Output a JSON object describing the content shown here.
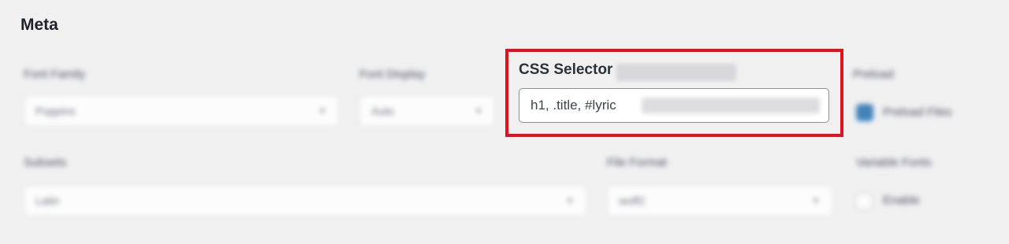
{
  "section": {
    "title": "Meta"
  },
  "fields": {
    "font_family": {
      "label": "Font Family",
      "value": "Poppins"
    },
    "font_display": {
      "label": "Font Display",
      "value": "Auto"
    },
    "css_selector": {
      "label": "CSS Selector",
      "value": "h1, .title, #lyric"
    },
    "preload": {
      "label": "Preload",
      "checkbox_label": "Preload Files",
      "checked": true
    },
    "subsets": {
      "label": "Subsets",
      "value": "Latin"
    },
    "file_format": {
      "label": "File Format",
      "value": "woff2"
    },
    "variable_fonts": {
      "label": "Variable Fonts",
      "checkbox_label": "Enable",
      "checked": false
    }
  },
  "colors": {
    "highlight": "#e1121b",
    "accent": "#2271b1",
    "background": "#f0f0f1"
  }
}
